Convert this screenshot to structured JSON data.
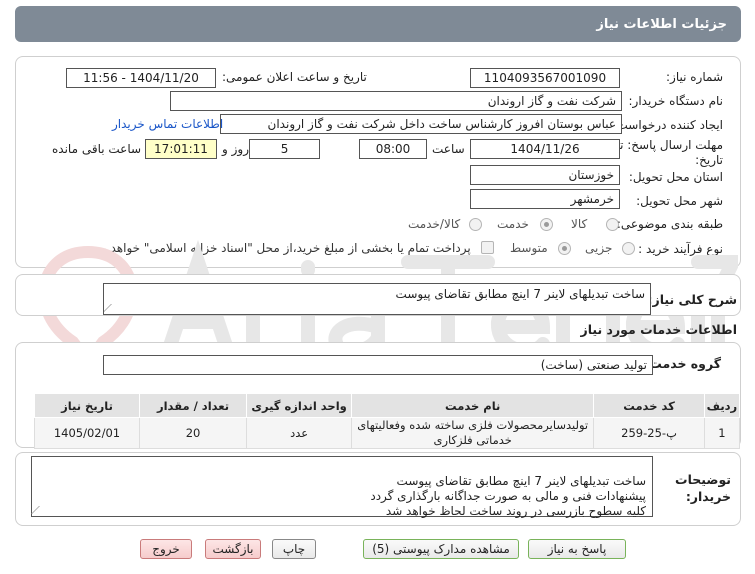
{
  "header": {
    "title": "جزئیات اطلاعات نیاز"
  },
  "form": {
    "need_number_label": "شماره نیاز:",
    "need_number": "1104093567001090",
    "announce_label": "تاریخ و ساعت اعلان عمومی:",
    "announce_value": "1404/11/20 - 11:56",
    "buyer_org_label": "نام دستگاه خریدار:",
    "buyer_org": "شرکت نفت و گاز اروندان",
    "creator_label": "ایجاد کننده درخواست:",
    "creator": "عباس بوستان افروز کارشناس ساخت داخل شرکت نفت و گاز اروندان",
    "contact_link": "اطلاعات تماس خریدار",
    "deadline_label_1": "مهلت ارسال پاسخ: تا",
    "deadline_label_2": "تاریخ:",
    "deadline_date": "1404/11/26",
    "time_label": "ساعت",
    "deadline_time": "08:00",
    "days_value": "5",
    "days_label": "روز و",
    "remaining_time": "17:01:11",
    "remaining_label": "ساعت باقی مانده",
    "province_label": "استان محل تحویل:",
    "province": "خوزستان",
    "city_label": "شهر محل تحویل:",
    "city": "خرمشهر",
    "category_label": "طبقه بندی موضوعی:",
    "category_options": [
      "کالا",
      "خدمت",
      "کالا/خدمت"
    ],
    "category_selected": "خدمت",
    "purchase_type_label": "نوع فرآیند خرید :",
    "purchase_options": [
      "جزیی",
      "متوسط"
    ],
    "purchase_selected": "متوسط",
    "payment_note": "پرداخت تمام یا بخشی از مبلغ خرید،از محل \"اسناد خزانه اسلامی\" خواهد بود."
  },
  "summary": {
    "label": "شرح کلی نیاز:",
    "value": "ساخت تبدیلهای لاینر 7 اینچ مطابق تقاضای پیوست"
  },
  "services": {
    "section_title": "اطلاعات خدمات مورد نیاز",
    "group_label": "گروه خدمت:",
    "group_value": "تولید صنعتی (ساخت)",
    "columns": [
      "ردیف",
      "کد خدمت",
      "نام خدمت",
      "واحد اندازه گیری",
      "تعداد / مقدار",
      "تاریخ نیاز"
    ],
    "rows": [
      {
        "row": "1",
        "code": "پ-25-259",
        "name": "تولیدسایرمحصولات فلزی ساخته شده وفعالیتهای خدماتی فلزکاری",
        "unit": "عدد",
        "qty": "20",
        "date": "1405/02/01"
      }
    ]
  },
  "buyer_notes": {
    "label_1": "توضیحات",
    "label_2": "خریدار:",
    "text": "ساخت تبدیلهای لاینر 7 اینچ مطابق تقاضای پیوست\nپیشنهادات فنی و مالی به صورت جداگانه بارگذاری گردد\nکلیه سطوح بازرسی در روند ساخت لحاظ خواهد شد"
  },
  "buttons": {
    "reply": "پاسخ به نیاز",
    "view_docs": "مشاهده مدارک پیوستی (5)",
    "print": "چاپ",
    "back": "بازگشت",
    "exit": "خروج"
  },
  "colors": {
    "header_bg": "#7f8a96",
    "watermark": "#e7e7e7",
    "watermark_accent": "#f3d9d9",
    "link": "#1a56c8",
    "remaining_bg": "#ffffc8"
  }
}
